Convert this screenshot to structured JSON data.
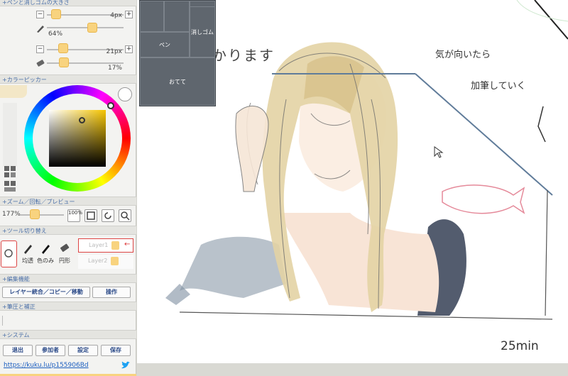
{
  "panel": {
    "pen_section": {
      "header": "+ペンと消しゴムの大きさ",
      "pen_size": "4px",
      "pen_opacity": "64%",
      "eraser_size": "21px",
      "eraser_opacity": "17%"
    },
    "color_section": {
      "header": "+カラーピッカー",
      "hue_color": "#f5c400",
      "primary": "#f3e7c7"
    },
    "zoom_section": {
      "header": "+ズーム／回転／プレビュー",
      "zoom": "177%",
      "reset_label": "100%"
    },
    "tool_section": {
      "header": "+ツール切り替え",
      "tools": [
        "均透",
        "色のみ",
        "円形"
      ],
      "layers": [
        "Layer1",
        "Layer2"
      ]
    },
    "edit_section": {
      "header": "+編集機能",
      "merge_btn": "レイヤー統合／コピー／移動",
      "ops_btn": "操作"
    },
    "pressure_section": {
      "header": "+筆圧と補正"
    },
    "system_section": {
      "header": "+システム",
      "buttons": [
        "退出",
        "参加者",
        "設定",
        "保存"
      ],
      "link": "https://kuku.lu/p155906Bd"
    }
  },
  "palette": {
    "pen_label": "ペン",
    "eraser_label": "消しゴム",
    "hand_label": "おてて"
  },
  "canvas": {
    "note_top": "この辺かります",
    "note_right_1": "気が向いたら",
    "note_right_2": "加筆していく",
    "time_note": "25min"
  }
}
